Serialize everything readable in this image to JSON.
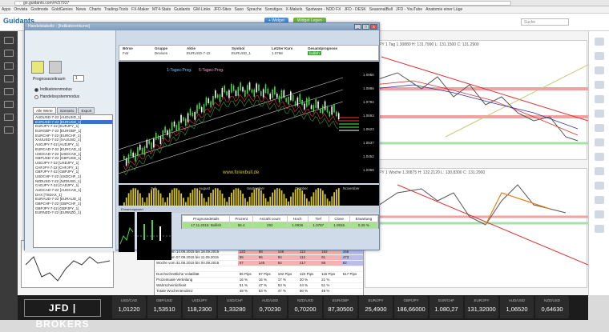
{
  "browser": {
    "url": "go.guidants.com/#c57937",
    "bookmarks": [
      "Apps",
      "Onvista",
      "Godmode",
      "GoldGenies",
      "News",
      "Charts",
      "Trading-Tools",
      "FX-Maker",
      "MT4-Stats",
      "Guidants",
      "GM-Links",
      "JFD-Sites",
      "Saxo",
      "Sprache",
      "Sonstiges",
      "X-Makels",
      "Spotware - NDD FX",
      "JFD - DESK",
      "SeasonalBull",
      "JFD - YouTube",
      "Anatomie einer Lüge"
    ]
  },
  "guidants": {
    "logo": "Guidants",
    "buttons": [
      "+ Widget",
      "Widget Legen"
    ],
    "search_placeholder": "Suche"
  },
  "window": {
    "title": "Handelstabelle - [Indikatorenkurve]",
    "controls": [
      "_",
      "□",
      "x"
    ]
  },
  "sidebar": {
    "priority_label": "Prognosezeitraum",
    "priority_value": "1",
    "radio_options": [
      {
        "label": "Indikatorenmodus",
        "on": true
      },
      {
        "label": "Handelssystemmodus",
        "on": false
      }
    ],
    "tabs": [
      "Alle Werte",
      "Szenario",
      "Export"
    ],
    "symbols": [
      "AUDUSD-7-22 [AUDUSD_1]",
      "EURUSD-7-22 [EURUSD_1]",
      "EURJPY-7-22 [EURJPY_1]",
      "EURGBP-7-22 [EURGBP_1]",
      "EURCHF-7-22 [EURCHF_1]",
      "XAUUSD-7-22 [XAUUSD_1]",
      "AUDJPY-7-22 [AUDJPY_1]",
      "EURCAD-7-22 [EURCAD_1]",
      "USDCAD-7-22 [USDCAD_1]",
      "GBPUSD-7-22 [GBPUSD_1]",
      "USDJPY-7-22 [USDJPY_1]",
      "CHFJPY-7-22 [CHFJPY_1]",
      "GBPJPY-7-22 [GBPJPY_1]",
      "USDCHF-7-22 [USDCHF_1]",
      "NZDUSD-7-22 [NZDUSD_1]",
      "CADJPY-7-22 [CADJPY_1]",
      "AUDCAD-7-22 [AUDCAD_1]",
      "DAX [TSDAX_1]",
      "EURAUD-7-22 [EURAUD_1]",
      "GBPCHF-7-22 [GBPCHF_1]",
      "GBPJPY-7-22 [GBPJPY_1]",
      "EURNZD-7-22 [EURNZD_1]"
    ],
    "selected_index": 1
  },
  "info": {
    "headers": [
      "Börse",
      "Gruppe",
      "Aktie",
      "Symbol",
      "Letzter Kurs",
      "Gesamtprognose"
    ],
    "values": [
      "Fxtr",
      "Devisen",
      "EURUSD-7-22",
      "EURUSD_1",
      "1.0768",
      "bullish"
    ]
  },
  "chart": {
    "legend_blue": "1-Tages-Prog.",
    "legend_pink": "5-Tages-Prog.",
    "watermark": "www.forexbull.de",
    "y_ticks": [
      "1.0966",
      "1.0886",
      "1.0794",
      "1.0693",
      "1.0623",
      "1.0537",
      "1.0452",
      "1.0368"
    ],
    "x_ticks": [
      "Juli",
      "August",
      "September",
      "Oktober",
      "November"
    ]
  },
  "progtable": {
    "headers": [
      "Prognosedetails",
      "Prozent",
      "Anzahl count",
      "Hoch",
      "Tief",
      "Close",
      "Erwartung"
    ],
    "row": [
      "17.11.2015: Bullish",
      "55.4",
      "292",
      "1.0836",
      "1.0787",
      "1.0816",
      "0.25 %"
    ]
  },
  "volume_label": "Erwartungswert",
  "stats": {
    "rows": [
      [
        "Woche vom 14.09.2015 bis 18.09.2015",
        "122",
        "68",
        "146",
        "112",
        "152",
        "166"
      ],
      [
        "Woche vom 07.09.2015 bis 11.09.2015",
        "55",
        "96",
        "94",
        "112",
        "91",
        "473"
      ],
      [
        "Woche vom 31.08.2015 bis 04.09.2015",
        "67",
        "145",
        "64",
        "217",
        "95",
        "82"
      ],
      [
        "",
        "",
        "",
        "",
        "",
        "",
        ""
      ],
      [
        "Durchschnittliche Volatilität",
        "96 Pips",
        "97 Pips",
        "102 Pips",
        "123 Pips",
        "115 Pips",
        "517 Pips"
      ],
      [
        "Prozentuale Verteilung",
        "16 %",
        "16 %",
        "17 %",
        "20 %",
        "21 %",
        ""
      ],
      [
        "Wahrscheinlichkeit",
        "51 %",
        "47 %",
        "53 %",
        "44 %",
        "51 %",
        ""
      ],
      [
        "Totale Wochentendenz",
        "49 %",
        "53 %",
        "47 %",
        "56 %",
        "49 %",
        ""
      ]
    ]
  },
  "bg": {
    "chart1_title": "EURJPY 1 Tag 1.30880 H: 131.7990 L: 131.1500 C: 131.2900",
    "chart2_title": "EURJPY 1 Woche 1.30875 H: 132.2120 L: 130.8300 C: 131.2900"
  },
  "jfd": {
    "logo": "JFD | BROKERS",
    "tickers": [
      {
        "name": "USD/CAD",
        "value": "1,01220"
      },
      {
        "name": "GBP/USD",
        "value": "1,53510"
      },
      {
        "name": "USD/JPY",
        "value": "118,2300"
      },
      {
        "name": "USD/CHF",
        "value": "1,33280"
      },
      {
        "name": "AUD/USD",
        "value": "0,70230"
      },
      {
        "name": "NZD/USD",
        "value": "0,70200"
      },
      {
        "name": "EUR/GBP",
        "value": "87,30500"
      },
      {
        "name": "EUR/JPY",
        "value": "25,4900"
      },
      {
        "name": "GBP/JPY",
        "value": "186,66000"
      },
      {
        "name": "EUR/CHF",
        "value": "1.080,27"
      },
      {
        "name": "EUR/JPY",
        "value": "131,32000"
      },
      {
        "name": "AUD/USD",
        "value": "1,06520"
      },
      {
        "name": "NZD/USD",
        "value": "0,64630"
      }
    ]
  },
  "colors": {
    "accent": "#1d6aa5",
    "bull_green": "#41a341",
    "candle_bull": "#4ad34a",
    "candle_bear": "#ffffff",
    "volume": "#d8c52a"
  }
}
